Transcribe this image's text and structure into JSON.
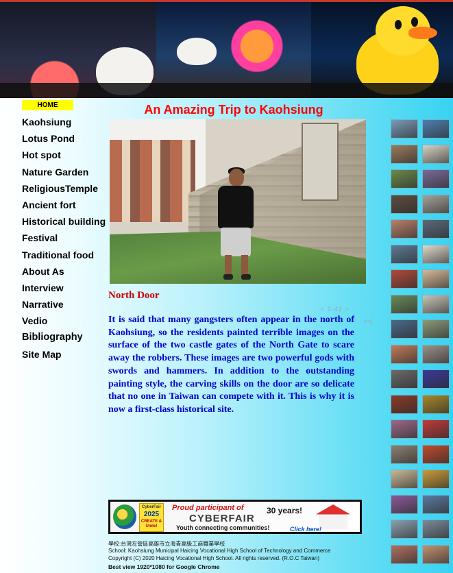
{
  "nav": {
    "home": "HOME",
    "items": [
      "Kaohsiung",
      "Lotus Pond",
      "Hot spot",
      "Nature Garden",
      "ReligiousTemple",
      "Ancient fort",
      "Historical building",
      "Festival",
      "Traditional food",
      "About As",
      "Interview",
      "Narrative",
      "Vedio",
      "Bibliography",
      "Site Map"
    ]
  },
  "page": {
    "title": "An Amazing Trip to Kaohsiung",
    "caption": "North Door",
    "pager": "< 2-42 >",
    "pager_next": ">>|",
    "body": "It is said that many gangsters often appear in the north of Kaohsiung, so the residents painted terrible images on the surface of the two castle gates of the North Gate to scare away the robbers. These images are two powerful gods with swords and hammers. In addition to the outstanding painting style, the carving skills on the door are so delicate that no one in Taiwan can compete with it. This is why it is now a first-class historical site."
  },
  "banner_ad": {
    "badge_top": "CyberFair",
    "badge_year": "2025",
    "badge_create": "CREATE & Unite!",
    "proud": "Proud participant of",
    "name": "CYBERFAIR",
    "years": "30 years!",
    "slogan": "Youth connecting communities!",
    "click": "Click here!"
  },
  "footer": {
    "line1": "學校:台灣左營區高雄市立海青高級工商職業學校",
    "line2": "School:  Kaohsiung Municipal Haicing Vocational High School of Technology and Commerce",
    "line3": "Copyright (C) 2020 Haicing Vocational High School. All rights reserved. (R.O.C Taiwan)",
    "line4": "Best view 1920*1080 for Google Chrome"
  },
  "thumbnails": {
    "colors": [
      "#7a9bb8",
      "#4f7fb0",
      "#9a7a5c",
      "#d8d2c4",
      "#6a8a4a",
      "#7a6a9a",
      "#5e4c3e",
      "#a6a29a",
      "#b8806a",
      "#5a6a7a",
      "#5c7a96",
      "#e0d8cc",
      "#b04a3a",
      "#d4b898",
      "#6a8a5a",
      "#c8c4b8",
      "#4a6a8a",
      "#8a9a7a",
      "#c07a5a",
      "#9a9088",
      "#6a6a6a",
      "#3a3a9a",
      "#8a3a2a",
      "#a8882a",
      "#9a6a8a",
      "#c03a3a",
      "#8a8070",
      "#c04a2a",
      "#c8b896",
      "#c89a3a",
      "#8a5a9a",
      "#5a7aa0",
      "#8aa0b0",
      "#7a8a9a",
      "#b07060",
      "#c09070"
    ]
  }
}
